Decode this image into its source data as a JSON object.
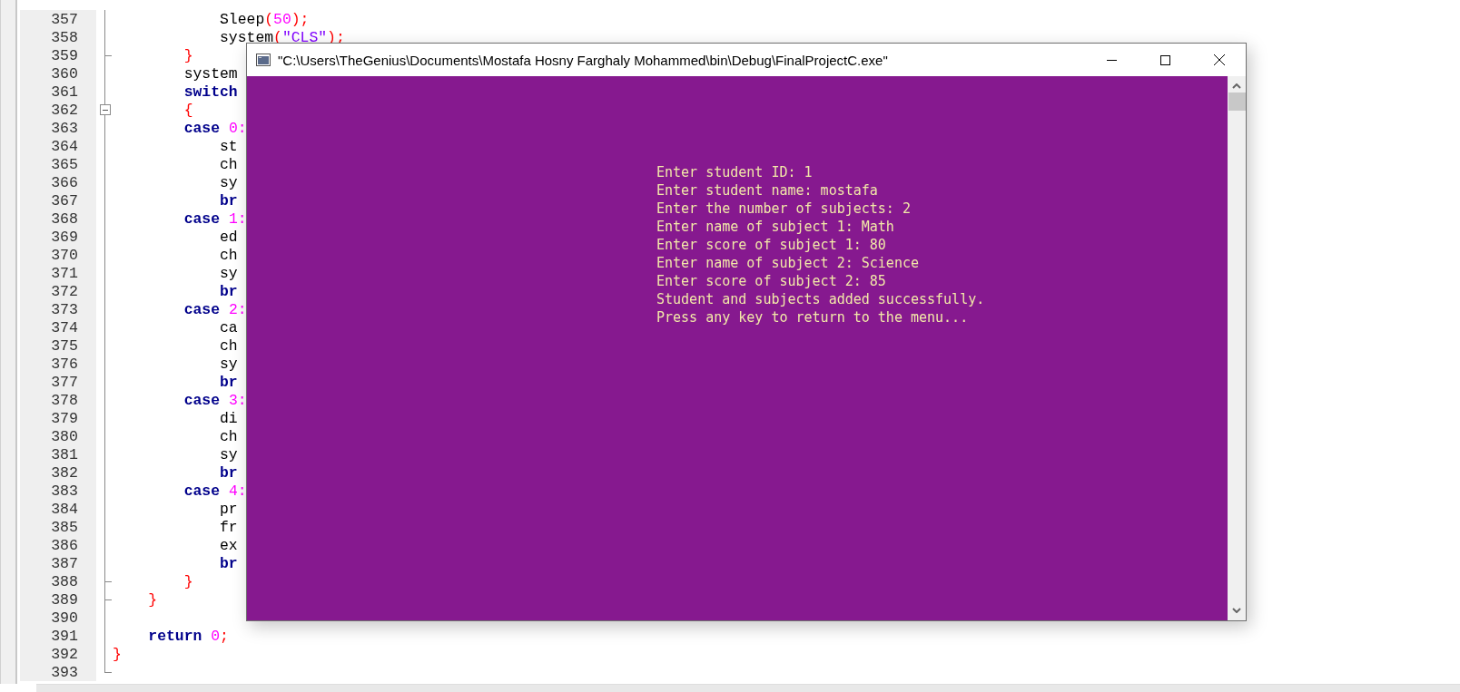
{
  "editor": {
    "lines": [
      {
        "number": "357",
        "kind": "plain",
        "tokens": [
          {
            "t": "            Sleep",
            "kind": "plain"
          },
          {
            "t": "(",
            "kind": "operator"
          },
          {
            "t": "50",
            "kind": "number"
          },
          {
            "t": ");",
            "kind": "operator"
          }
        ]
      },
      {
        "number": "358",
        "kind": "plain",
        "tokens": [
          {
            "t": "            system",
            "kind": "plain"
          },
          {
            "t": "(",
            "kind": "operator"
          },
          {
            "t": "\"CLS\"",
            "kind": "string"
          },
          {
            "t": ");",
            "kind": "operator"
          }
        ]
      },
      {
        "number": "359",
        "kind": "fold_end",
        "tokens": [
          {
            "t": "        }",
            "kind": "operator"
          }
        ]
      },
      {
        "number": "360",
        "kind": "plain",
        "tokens": [
          {
            "t": "        system",
            "kind": "plain"
          }
        ]
      },
      {
        "number": "361",
        "kind": "plain",
        "tokens": [
          {
            "t": "        switch",
            "kind": "keyword"
          }
        ]
      },
      {
        "number": "362",
        "kind": "fold_start",
        "tokens": [
          {
            "t": "        {",
            "kind": "operator"
          }
        ]
      },
      {
        "number": "363",
        "kind": "plain",
        "tokens": [
          {
            "t": "        case",
            "kind": "keyword"
          },
          {
            "t": " 0:",
            "kind": "number"
          }
        ]
      },
      {
        "number": "364",
        "kind": "plain",
        "tokens": [
          {
            "t": "            st",
            "kind": "plain"
          }
        ]
      },
      {
        "number": "365",
        "kind": "plain",
        "tokens": [
          {
            "t": "            ch",
            "kind": "plain"
          }
        ]
      },
      {
        "number": "366",
        "kind": "plain",
        "tokens": [
          {
            "t": "            sy",
            "kind": "plain"
          }
        ]
      },
      {
        "number": "367",
        "kind": "plain",
        "tokens": [
          {
            "t": "            br",
            "kind": "keyword"
          }
        ]
      },
      {
        "number": "368",
        "kind": "plain",
        "tokens": [
          {
            "t": "        case",
            "kind": "keyword"
          },
          {
            "t": " 1:",
            "kind": "number"
          }
        ]
      },
      {
        "number": "369",
        "kind": "plain",
        "tokens": [
          {
            "t": "            ed",
            "kind": "plain"
          }
        ]
      },
      {
        "number": "370",
        "kind": "plain",
        "tokens": [
          {
            "t": "            ch",
            "kind": "plain"
          }
        ]
      },
      {
        "number": "371",
        "kind": "plain",
        "tokens": [
          {
            "t": "            sy",
            "kind": "plain"
          }
        ]
      },
      {
        "number": "372",
        "kind": "plain",
        "tokens": [
          {
            "t": "            br",
            "kind": "keyword"
          }
        ]
      },
      {
        "number": "373",
        "kind": "plain",
        "tokens": [
          {
            "t": "        case",
            "kind": "keyword"
          },
          {
            "t": " 2:",
            "kind": "number"
          }
        ]
      },
      {
        "number": "374",
        "kind": "plain",
        "tokens": [
          {
            "t": "            ca",
            "kind": "plain"
          }
        ]
      },
      {
        "number": "375",
        "kind": "plain",
        "tokens": [
          {
            "t": "            ch",
            "kind": "plain"
          }
        ]
      },
      {
        "number": "376",
        "kind": "plain",
        "tokens": [
          {
            "t": "            sy",
            "kind": "plain"
          }
        ]
      },
      {
        "number": "377",
        "kind": "plain",
        "tokens": [
          {
            "t": "            br",
            "kind": "keyword"
          }
        ]
      },
      {
        "number": "378",
        "kind": "plain",
        "tokens": [
          {
            "t": "        case",
            "kind": "keyword"
          },
          {
            "t": " 3:",
            "kind": "number"
          }
        ]
      },
      {
        "number": "379",
        "kind": "plain",
        "tokens": [
          {
            "t": "            di",
            "kind": "plain"
          }
        ]
      },
      {
        "number": "380",
        "kind": "plain",
        "tokens": [
          {
            "t": "            ch",
            "kind": "plain"
          }
        ]
      },
      {
        "number": "381",
        "kind": "plain",
        "tokens": [
          {
            "t": "            sy",
            "kind": "plain"
          }
        ]
      },
      {
        "number": "382",
        "kind": "plain",
        "tokens": [
          {
            "t": "            br",
            "kind": "keyword"
          }
        ]
      },
      {
        "number": "383",
        "kind": "plain",
        "tokens": [
          {
            "t": "        case",
            "kind": "keyword"
          },
          {
            "t": " 4:",
            "kind": "number"
          }
        ]
      },
      {
        "number": "384",
        "kind": "plain",
        "tokens": [
          {
            "t": "            pr",
            "kind": "plain"
          }
        ]
      },
      {
        "number": "385",
        "kind": "plain",
        "tokens": [
          {
            "t": "            fr",
            "kind": "plain"
          }
        ]
      },
      {
        "number": "386",
        "kind": "plain",
        "tokens": [
          {
            "t": "            ex",
            "kind": "plain"
          }
        ]
      },
      {
        "number": "387",
        "kind": "plain",
        "tokens": [
          {
            "t": "            br",
            "kind": "keyword"
          }
        ]
      },
      {
        "number": "388",
        "kind": "fold_end",
        "tokens": [
          {
            "t": "        }",
            "kind": "operator"
          }
        ]
      },
      {
        "number": "389",
        "kind": "fold_end",
        "tokens": [
          {
            "t": "    }",
            "kind": "operator"
          }
        ]
      },
      {
        "number": "390",
        "kind": "plain"
      },
      {
        "number": "391",
        "kind": "plain",
        "tokens": [
          {
            "t": "    return",
            "kind": "keyword"
          },
          {
            "t": " 0",
            "kind": "number"
          },
          {
            "t": ";",
            "kind": "operator"
          }
        ]
      },
      {
        "number": "392",
        "kind": "plain",
        "tokens": [
          {
            "t": "}",
            "kind": "operator"
          }
        ]
      },
      {
        "number": "393",
        "kind": "fold_end"
      }
    ]
  },
  "console": {
    "title": "\"C:\\Users\\TheGenius\\Documents\\Mostafa Hosny Farghaly Mohammed\\bin\\Debug\\FinalProjectC.exe\"",
    "lines": [
      "Enter student ID: 1",
      "Enter student name: mostafa",
      "Enter the number of subjects: 2",
      "Enter name of subject 1: Math",
      "Enter score of subject 1: 80",
      "Enter name of subject 2: Science",
      "Enter score of subject 2: 85",
      "Student and subjects added successfully.",
      "Press any key to return to the menu..."
    ]
  }
}
